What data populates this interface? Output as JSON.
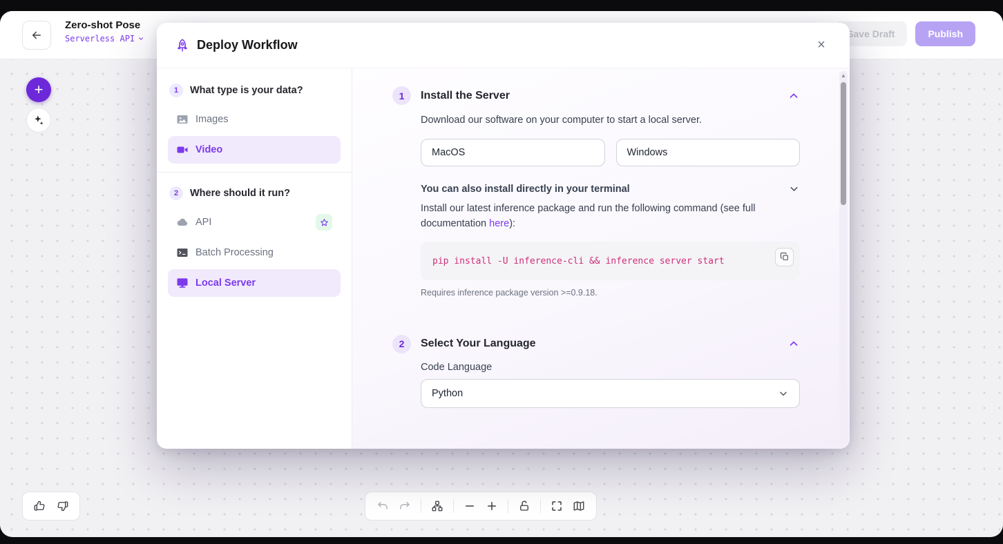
{
  "header": {
    "title": "Zero-shot Pose",
    "subtitle": "Serverless API",
    "save_draft": "Save Draft",
    "publish": "Publish"
  },
  "modal": {
    "title": "Deploy Workflow",
    "close": "×",
    "sidebar": {
      "steps": [
        {
          "number": "1",
          "title": "What type is your data?",
          "items": [
            {
              "label": "Images"
            },
            {
              "label": "Video"
            }
          ]
        },
        {
          "number": "2",
          "title": "Where should it run?",
          "items": [
            {
              "label": "API"
            },
            {
              "label": "Batch Processing"
            },
            {
              "label": "Local Server"
            }
          ]
        }
      ]
    },
    "sections": [
      {
        "number": "1",
        "title": "Install the Server",
        "description": "Download our software on your computer to start a local server.",
        "os_options": [
          "MacOS",
          "Windows"
        ],
        "terminal_toggle": "You can also install directly in your terminal",
        "install_before": "Install our latest inference package and run the following command (see full documentation ",
        "install_link": "here",
        "install_after": "):",
        "command": "pip install -U inference-cli && inference server start",
        "requirement": "Requires inference package version >=0.9.18."
      },
      {
        "number": "2",
        "title": "Select Your Language",
        "language_label": "Code Language",
        "language_value": "Python"
      }
    ]
  },
  "colors": {
    "accent": "#7c3aed",
    "selected_bg": "#f1eafd",
    "code_text": "#ce2f7b",
    "star_badge_bg": "#e4f8ea"
  }
}
